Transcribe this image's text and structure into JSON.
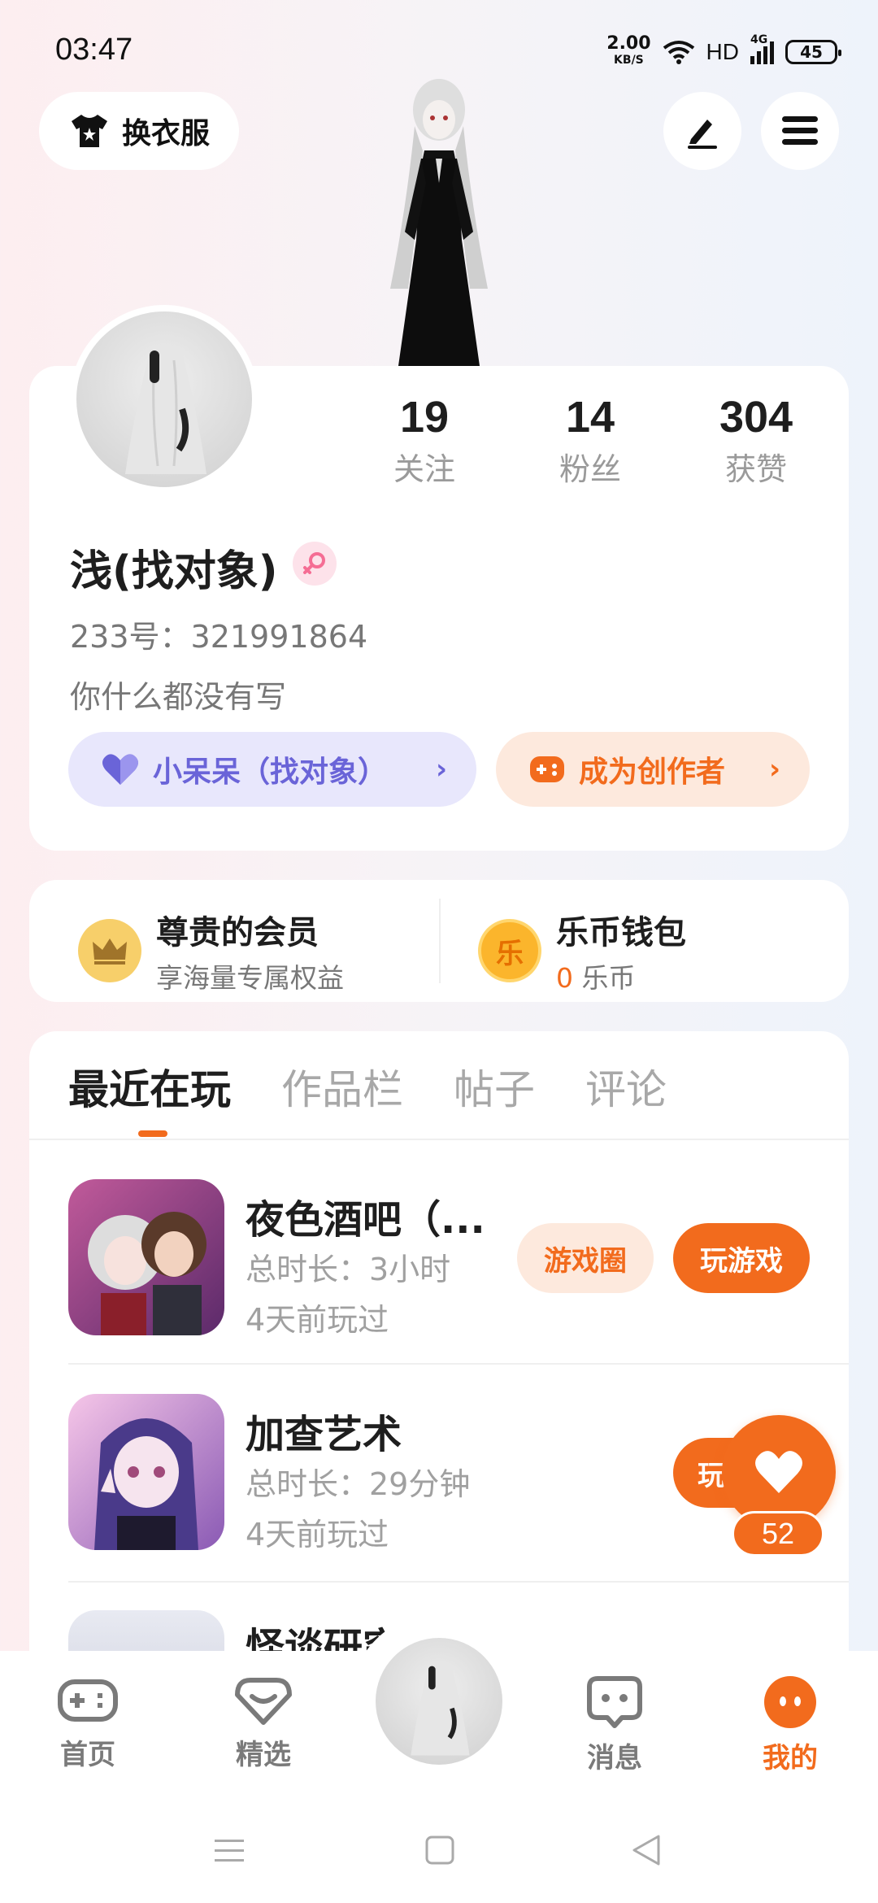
{
  "status": {
    "time": "03:47",
    "speed_value": "2.00",
    "speed_unit": "KB/S",
    "hd": "HD",
    "net": "4G",
    "battery": "45"
  },
  "top": {
    "outfit_label": "换衣服",
    "edit_icon": "pen-icon",
    "menu_icon": "menu-icon"
  },
  "stats": [
    {
      "value": "19",
      "label": "关注"
    },
    {
      "value": "14",
      "label": "粉丝"
    },
    {
      "value": "304",
      "label": "获赞"
    }
  ],
  "profile": {
    "name": "浅(找对象)",
    "gender": "female",
    "uid": "233号：321991864",
    "bio": "你什么都没有写",
    "partner_tag": "小呆呆（找对象）",
    "creator_tag": "成为创作者"
  },
  "member": {
    "vip_title": "尊贵的会员",
    "vip_sub": "享海量专属权益",
    "wallet_title": "乐币钱包",
    "wallet_amount": "0",
    "wallet_unit": "乐币",
    "coin_glyph": "乐"
  },
  "tabs": [
    "最近在玩",
    "作品栏",
    "帖子",
    "评论"
  ],
  "games": [
    {
      "title": "夜色酒吧（...",
      "duration": "总时长：3小时",
      "last": "4天前玩过",
      "circle_btn": "游戏圈",
      "play_btn": "玩游戏"
    },
    {
      "title": "加查艺术",
      "duration": "总时长：29分钟",
      "last": "4天前玩过",
      "play_btn": "玩"
    },
    {
      "title": "怪谈研究"
    }
  ],
  "fab": {
    "count": "52"
  },
  "nav": [
    {
      "label": "首页"
    },
    {
      "label": "精选"
    },
    {
      "label": "消息"
    },
    {
      "label": "我的"
    }
  ],
  "colors": {
    "accent": "#f26b1d",
    "purple": "#6a64d8",
    "purple_bg": "#e8e7fc",
    "orange_bg": "#fde9dd"
  }
}
